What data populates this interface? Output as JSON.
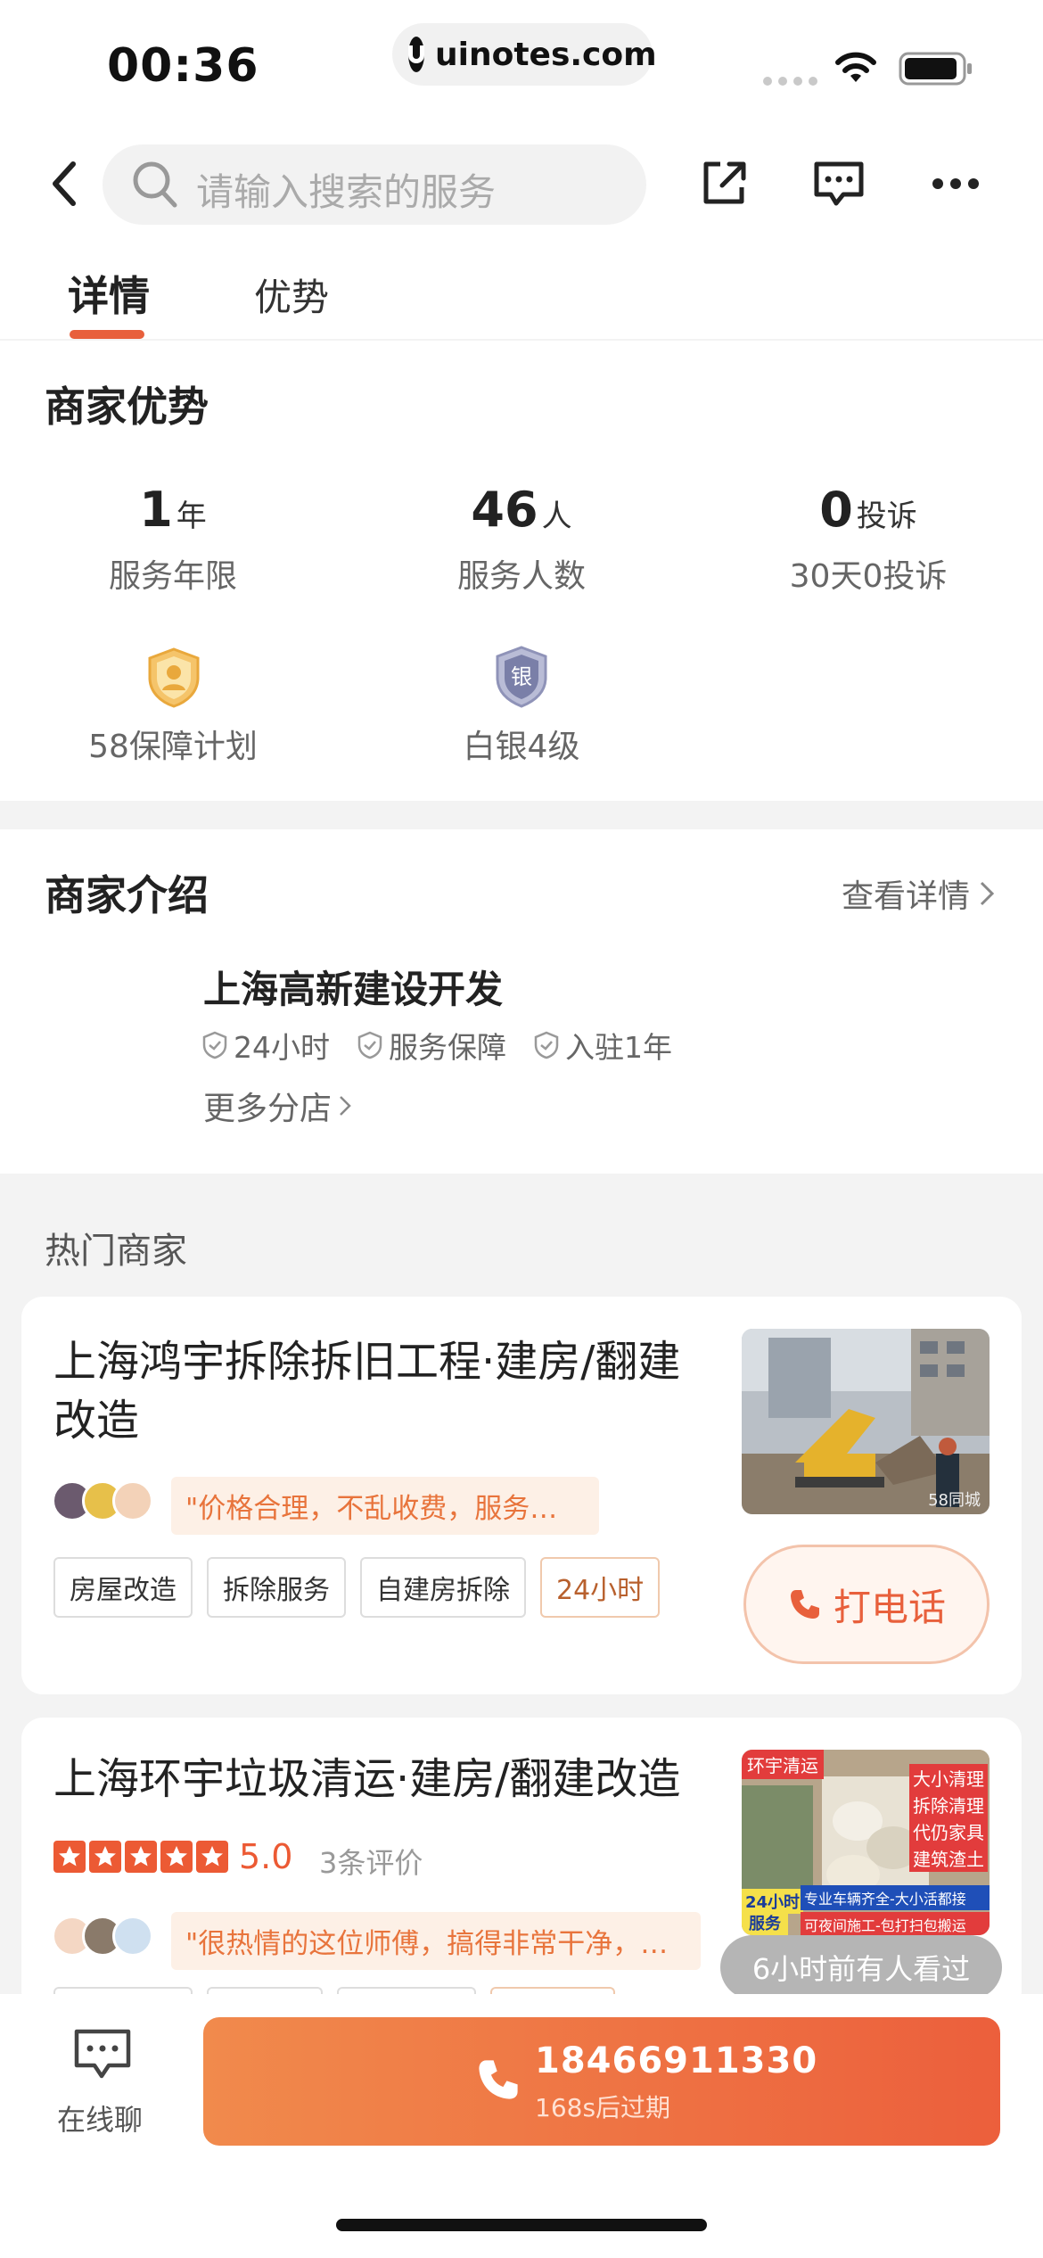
{
  "status_bar": {
    "time": "00:36",
    "url": "uinotes.com"
  },
  "nav": {
    "search_placeholder": "请输入搜索的服务"
  },
  "tabs": [
    {
      "label": "详情"
    },
    {
      "label": "优势"
    }
  ],
  "advantages": {
    "title": "商家优势",
    "stats": [
      {
        "value": "1",
        "unit": "年",
        "label": "服务年限"
      },
      {
        "value": "46",
        "unit": "人",
        "label": "服务人数"
      },
      {
        "value": "0",
        "unit": "投诉",
        "label": "30天0投诉"
      }
    ],
    "badges": [
      {
        "glyph": "",
        "label": "58保障计划",
        "icon": "shield-person-icon"
      },
      {
        "glyph": "银",
        "label": "白银4级",
        "icon": "silver-shield-icon"
      }
    ]
  },
  "intro": {
    "title": "商家介绍",
    "view_more": "查看详情",
    "company": "上海高新建设开发",
    "features": [
      "24小时",
      "服务保障",
      "入驻1年"
    ],
    "more_branches": "更多分店"
  },
  "hot": {
    "title": "热门商家",
    "merchants": [
      {
        "title": "上海鸿宇拆除拆旧工程·建房/翻建改造",
        "quote": "\"价格合理，不乱收费，服务不错\"",
        "tags": [
          "房屋改造",
          "拆除服务",
          "自建房拆除",
          "24小时"
        ],
        "call_label": "打电话",
        "thumb_watermark": "58同城"
      },
      {
        "title": "上海环宇垃圾清运·建房/翻建改造",
        "rating": "5.0",
        "reviews": "3条评价",
        "quote": "\"很热情的这位师傅，搞得非常干净，清...",
        "thumb_labels": [
          "环宇清运",
          "大小清理",
          "拆除清理",
          "代仍家具",
          "建筑渣土",
          "24小时",
          "服务",
          "专业车辆齐全-大小活都接",
          "可夜间施工-包打扫包搬运"
        ]
      }
    ]
  },
  "toast": "6小时前有人看过",
  "bottom": {
    "chat_label": "在线聊",
    "phone_number": "18466911330",
    "phone_expire": "168s后过期"
  },
  "colors": {
    "accent": "#e8603c",
    "quote_bg": "#fdf0e6",
    "star": "#ec5a34"
  }
}
